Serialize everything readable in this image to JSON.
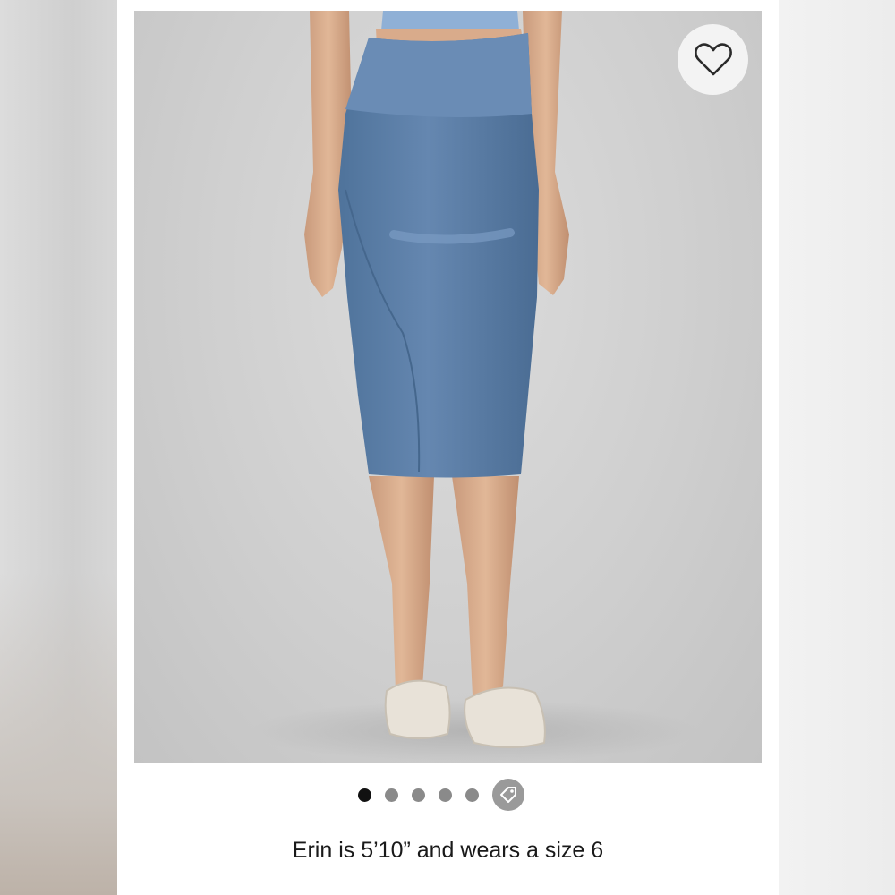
{
  "product": {
    "caption": "Erin is 5’10” and wears a size 6"
  },
  "gallery": {
    "slide_count": 5,
    "active_index": 0,
    "has_tag_indicator": true
  },
  "icons": {
    "favorite": "heart-outline-icon",
    "tag": "price-tag-icon"
  },
  "colors": {
    "skirt": "#5a7fa8",
    "background": "#d2d2d2",
    "active_dot": "#111111",
    "inactive_dot": "#8a8a8a"
  }
}
